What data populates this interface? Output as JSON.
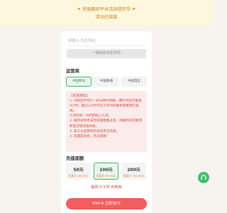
{
  "banner": {
    "notice_text": "充值期间平台活动提示中",
    "status_text": "活动已结束",
    "icon": "flag-icon"
  },
  "phone": {
    "placeholder": "请输入手机号码",
    "use_my_number_label": "一键获取本机号码"
  },
  "operator": {
    "title": "运营商",
    "options": [
      {
        "label": "中国移动",
        "selected": true
      },
      {
        "label": "中国联通",
        "selected": false
      },
      {
        "label": "中国电信",
        "selected": false
      }
    ]
  },
  "notice": {
    "title": "【充值须知】",
    "lines": [
      "1. 付款后平均5～30分钟内到账，繁忙时段可能会3小时，超过3小时可在工作时间联系客服进行查询。",
      "工作时间：9点至晚上21点。",
      "2. 每月初和月末因充值数量过多，到账时间可能有所延迟或充值失败。",
      "3. 非三大运营商的号码无法充值。",
      "4. 充值成功后，无法退款！"
    ]
  },
  "amount": {
    "title": "充值面额",
    "options": [
      {
        "value": "50元",
        "price": "优惠价 48.50元",
        "selected": false
      },
      {
        "value": "100元",
        "price": "优惠价 94.90元",
        "selected": true
      },
      {
        "value": "200元",
        "price": "优惠价 194.90元",
        "selected": false
      }
    ]
  },
  "arrival_note": "最低 0-3 时 内到账",
  "pay_button": "¥94.9 立即支付",
  "colors": {
    "accent_green": "#47b56a",
    "pay_red": "#f25d5d",
    "notice_red": "#d9453b",
    "banner_bg": "#fdf7dd",
    "banner_text": "#c87f1d"
  },
  "floating_button_icon": "customer-service-icon"
}
